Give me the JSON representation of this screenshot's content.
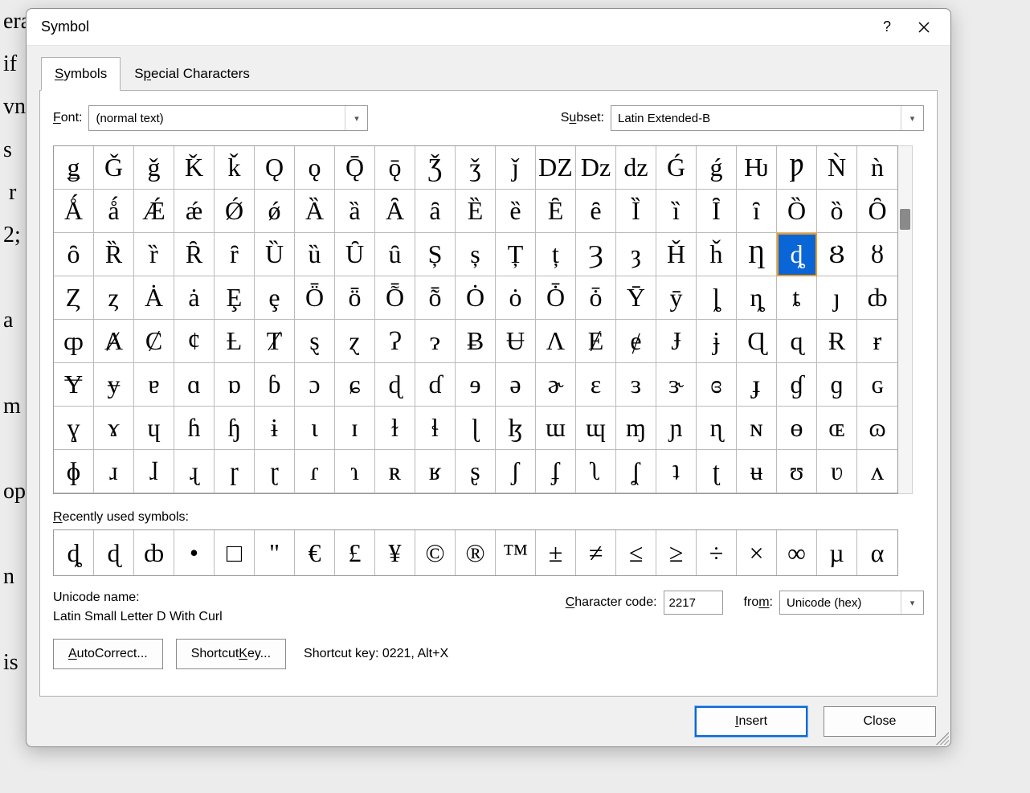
{
  "bg_lines": [
    "eral weeks following the earnings",
    "if",
    "vn",
    "s",
    " r",
    "2;",
    "",
    "a",
    "",
    "m",
    "",
    "op",
    "",
    "n",
    "",
    "is"
  ],
  "title": "Symbol",
  "tabs": {
    "symbols": "Symbols",
    "special": "Special Characters"
  },
  "font": {
    "label": "Font:",
    "value": "(normal text)"
  },
  "subset": {
    "label": "Subset:",
    "value": "Latin Extended-B"
  },
  "grid": {
    "cols": 21,
    "selected_index": 60,
    "chars": [
      "ǥ",
      "Ǧ",
      "ǧ",
      "Ǩ",
      "ǩ",
      "Ǫ",
      "ǫ",
      "Ǭ",
      "ǭ",
      "Ǯ",
      "ǯ",
      "ǰ",
      "Ǳ",
      "ǲ",
      "ǳ",
      "Ǵ",
      "ǵ",
      "Ƕ",
      "Ƿ",
      "Ǹ",
      "ǹ",
      "Ǻ",
      "ǻ",
      "Ǽ",
      "ǽ",
      "Ǿ",
      "ǿ",
      "Ȁ",
      "ȁ",
      "Ȃ",
      "ȃ",
      "Ȅ",
      "ȅ",
      "Ȇ",
      "ȇ",
      "Ȉ",
      "ȉ",
      "Ȋ",
      "ȋ",
      "Ȍ",
      "ȍ",
      "Ȏ",
      "ȏ",
      "Ȑ",
      "ȑ",
      "Ȓ",
      "ȓ",
      "Ȕ",
      "ȕ",
      "Ȗ",
      "ȗ",
      "Ș",
      "ș",
      "Ț",
      "ț",
      "Ȝ",
      "ȝ",
      "Ȟ",
      "ȟ",
      "Ƞ",
      "ȡ",
      "Ȣ",
      "ȣ",
      "Ȥ",
      "ȥ",
      "Ȧ",
      "ȧ",
      "Ȩ",
      "ȩ",
      "Ȫ",
      "ȫ",
      "Ȭ",
      "ȭ",
      "Ȯ",
      "ȯ",
      "Ȱ",
      "ȱ",
      "Ȳ",
      "ȳ",
      "ȴ",
      "ȵ",
      "ȶ",
      "ȷ",
      "ȸ",
      "ȹ",
      "Ⱥ",
      "Ȼ",
      "ȼ",
      "Ƚ",
      "Ⱦ",
      "ȿ",
      "ɀ",
      "Ɂ",
      "ɂ",
      "Ƀ",
      "Ʉ",
      "Ʌ",
      "Ɇ",
      "ɇ",
      "Ɉ",
      "ɉ",
      "Ɋ",
      "ɋ",
      "Ɍ",
      "ɍ",
      "Ɏ",
      "ɏ",
      "ɐ",
      "ɑ",
      "ɒ",
      "ɓ",
      "ɔ",
      "ɕ",
      "ɖ",
      "ɗ",
      "ɘ",
      "ə",
      "ɚ",
      "ɛ",
      "ɜ",
      "ɝ",
      "ɞ",
      "ɟ",
      "ɠ",
      "ɡ",
      "ɢ",
      "ɣ",
      "ɤ",
      "ɥ",
      "ɦ",
      "ɧ",
      "ɨ",
      "ɩ",
      "ɪ",
      "ɫ",
      "ɬ",
      "ɭ",
      "ɮ",
      "ɯ",
      "ɰ",
      "ɱ",
      "ɲ",
      "ɳ",
      "ɴ",
      "ɵ",
      "ɶ",
      "ɷ",
      "ɸ",
      "ɹ",
      "ɺ",
      "ɻ",
      "ɼ",
      "ɽ",
      "ɾ",
      "ɿ",
      "ʀ",
      "ʁ",
      "ʂ",
      "ʃ",
      "ʄ",
      "ʅ",
      "ʆ",
      "ʇ",
      "ʈ",
      "ʉ",
      "ʊ",
      "ʋ",
      "ʌ"
    ]
  },
  "recent": {
    "label": "Recently used symbols:",
    "chars": [
      "ȡ",
      "ɖ",
      "ȸ",
      "•",
      "□",
      "\"",
      "€",
      "£",
      "¥",
      "©",
      "®",
      "™",
      "±",
      "≠",
      "≤",
      "≥",
      "÷",
      "×",
      "∞",
      "µ",
      "α"
    ]
  },
  "unicode": {
    "name_label": "Unicode name:",
    "name_value": "Latin Small Letter D With Curl",
    "code_label": "Character code:",
    "code_value": "2217",
    "from_label": "from:",
    "from_value": "Unicode (hex)"
  },
  "buttons": {
    "autocorrect": "AutoCorrect...",
    "shortcut": "Shortcut Key...",
    "shortcut_note": "Shortcut key: 0221, Alt+X",
    "insert": "Insert",
    "close": "Close"
  }
}
